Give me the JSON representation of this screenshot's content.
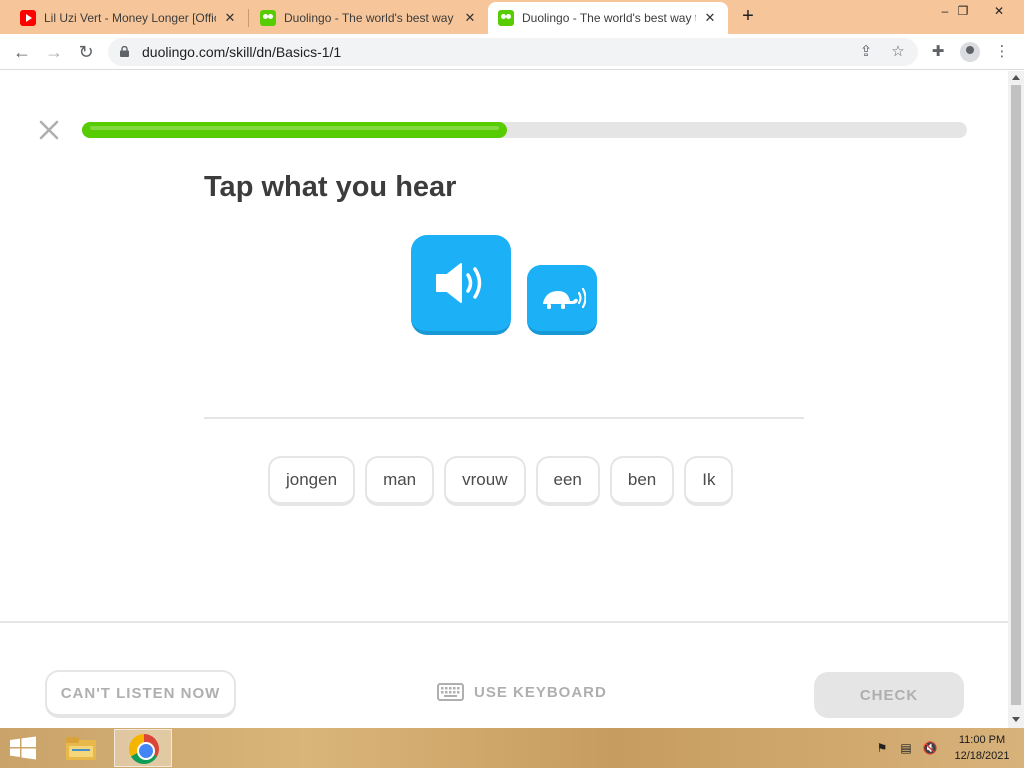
{
  "browser": {
    "tabs": [
      {
        "title": "Lil Uzi Vert - Money Longer [Official",
        "favicon": "youtube-icon",
        "active": false
      },
      {
        "title": "Duolingo - The world's best way to learn",
        "favicon": "duolingo-icon",
        "active": false
      },
      {
        "title": "Duolingo - The world's best way to learn",
        "favicon": "duolingo-icon",
        "active": true
      }
    ],
    "new_tab_symbol": "+",
    "window_controls": {
      "minimize": "–",
      "restore": "❐",
      "close": "✕"
    },
    "url": "duolingo.com/skill/dn/Basics-1/1"
  },
  "lesson": {
    "progress_fraction": 0.48,
    "prompt": "Tap what you hear",
    "word_bank": [
      "jongen",
      "man",
      "vrouw",
      "een",
      "ben",
      "Ik"
    ],
    "footer": {
      "cant_listen": "CAN'T LISTEN NOW",
      "use_keyboard": "USE KEYBOARD",
      "check": "CHECK"
    }
  },
  "taskbar": {
    "time": "11:00 PM",
    "date": "12/18/2021"
  },
  "colors": {
    "progress_green": "#58cc02",
    "audio_blue": "#1cb0f6",
    "tabstrip": "#f6c69a"
  }
}
